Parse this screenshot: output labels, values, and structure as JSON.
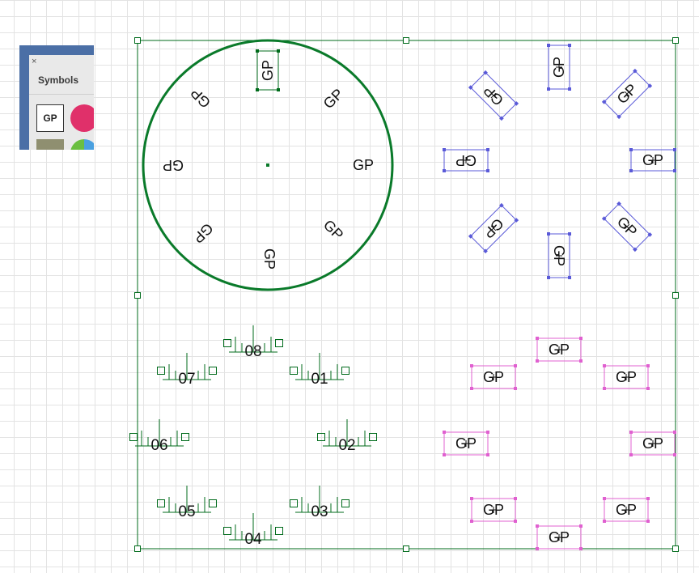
{
  "symbols_panel": {
    "close_glyph": "×",
    "title": "Symbols",
    "tiles": [
      {
        "name": "gp",
        "label": "GP"
      },
      {
        "name": "pink-circle",
        "color": "#e0306a"
      },
      {
        "name": "olive-square",
        "color": "#8f8f70"
      },
      {
        "name": "pie",
        "colors": [
          "#4aa0e0",
          "#6abf40"
        ]
      }
    ]
  },
  "colors": {
    "frame": "#006b1b",
    "circle": "#0a7a2a",
    "blue_selection": "#5a5ad8",
    "magenta_selection": "#e060d0",
    "text": "#111111"
  },
  "symbol_label": "GP",
  "tick_labels": [
    "01",
    "02",
    "03",
    "04",
    "05",
    "06",
    "07",
    "08"
  ]
}
